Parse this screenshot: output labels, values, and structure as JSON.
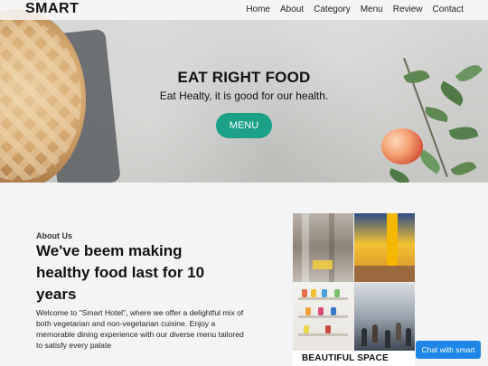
{
  "nav": {
    "logo": "SMART",
    "links": [
      "Home",
      "About",
      "Category",
      "Menu",
      "Review",
      "Contact"
    ]
  },
  "hero": {
    "title": "EAT RIGHT FOOD",
    "subtitle": "Eat Healty, it is good for our health.",
    "button_label": "MENU"
  },
  "about": {
    "kicker": "About Us",
    "title": "We've beem making healthy food last for 10 years",
    "text": "Welcome to \"Smart Hotel\", where we offer a delightful mix of both vegetarian and non-vegetarian cuisine. Enjoy a memorable dining experience with our diverse menu tailored to satisfy every palate",
    "image_caption": "BEAUTIFUL SPACE"
  },
  "chat": {
    "label": "Chat with smart"
  },
  "colors": {
    "accent": "#1aa187",
    "chat": "#1e86e6"
  }
}
